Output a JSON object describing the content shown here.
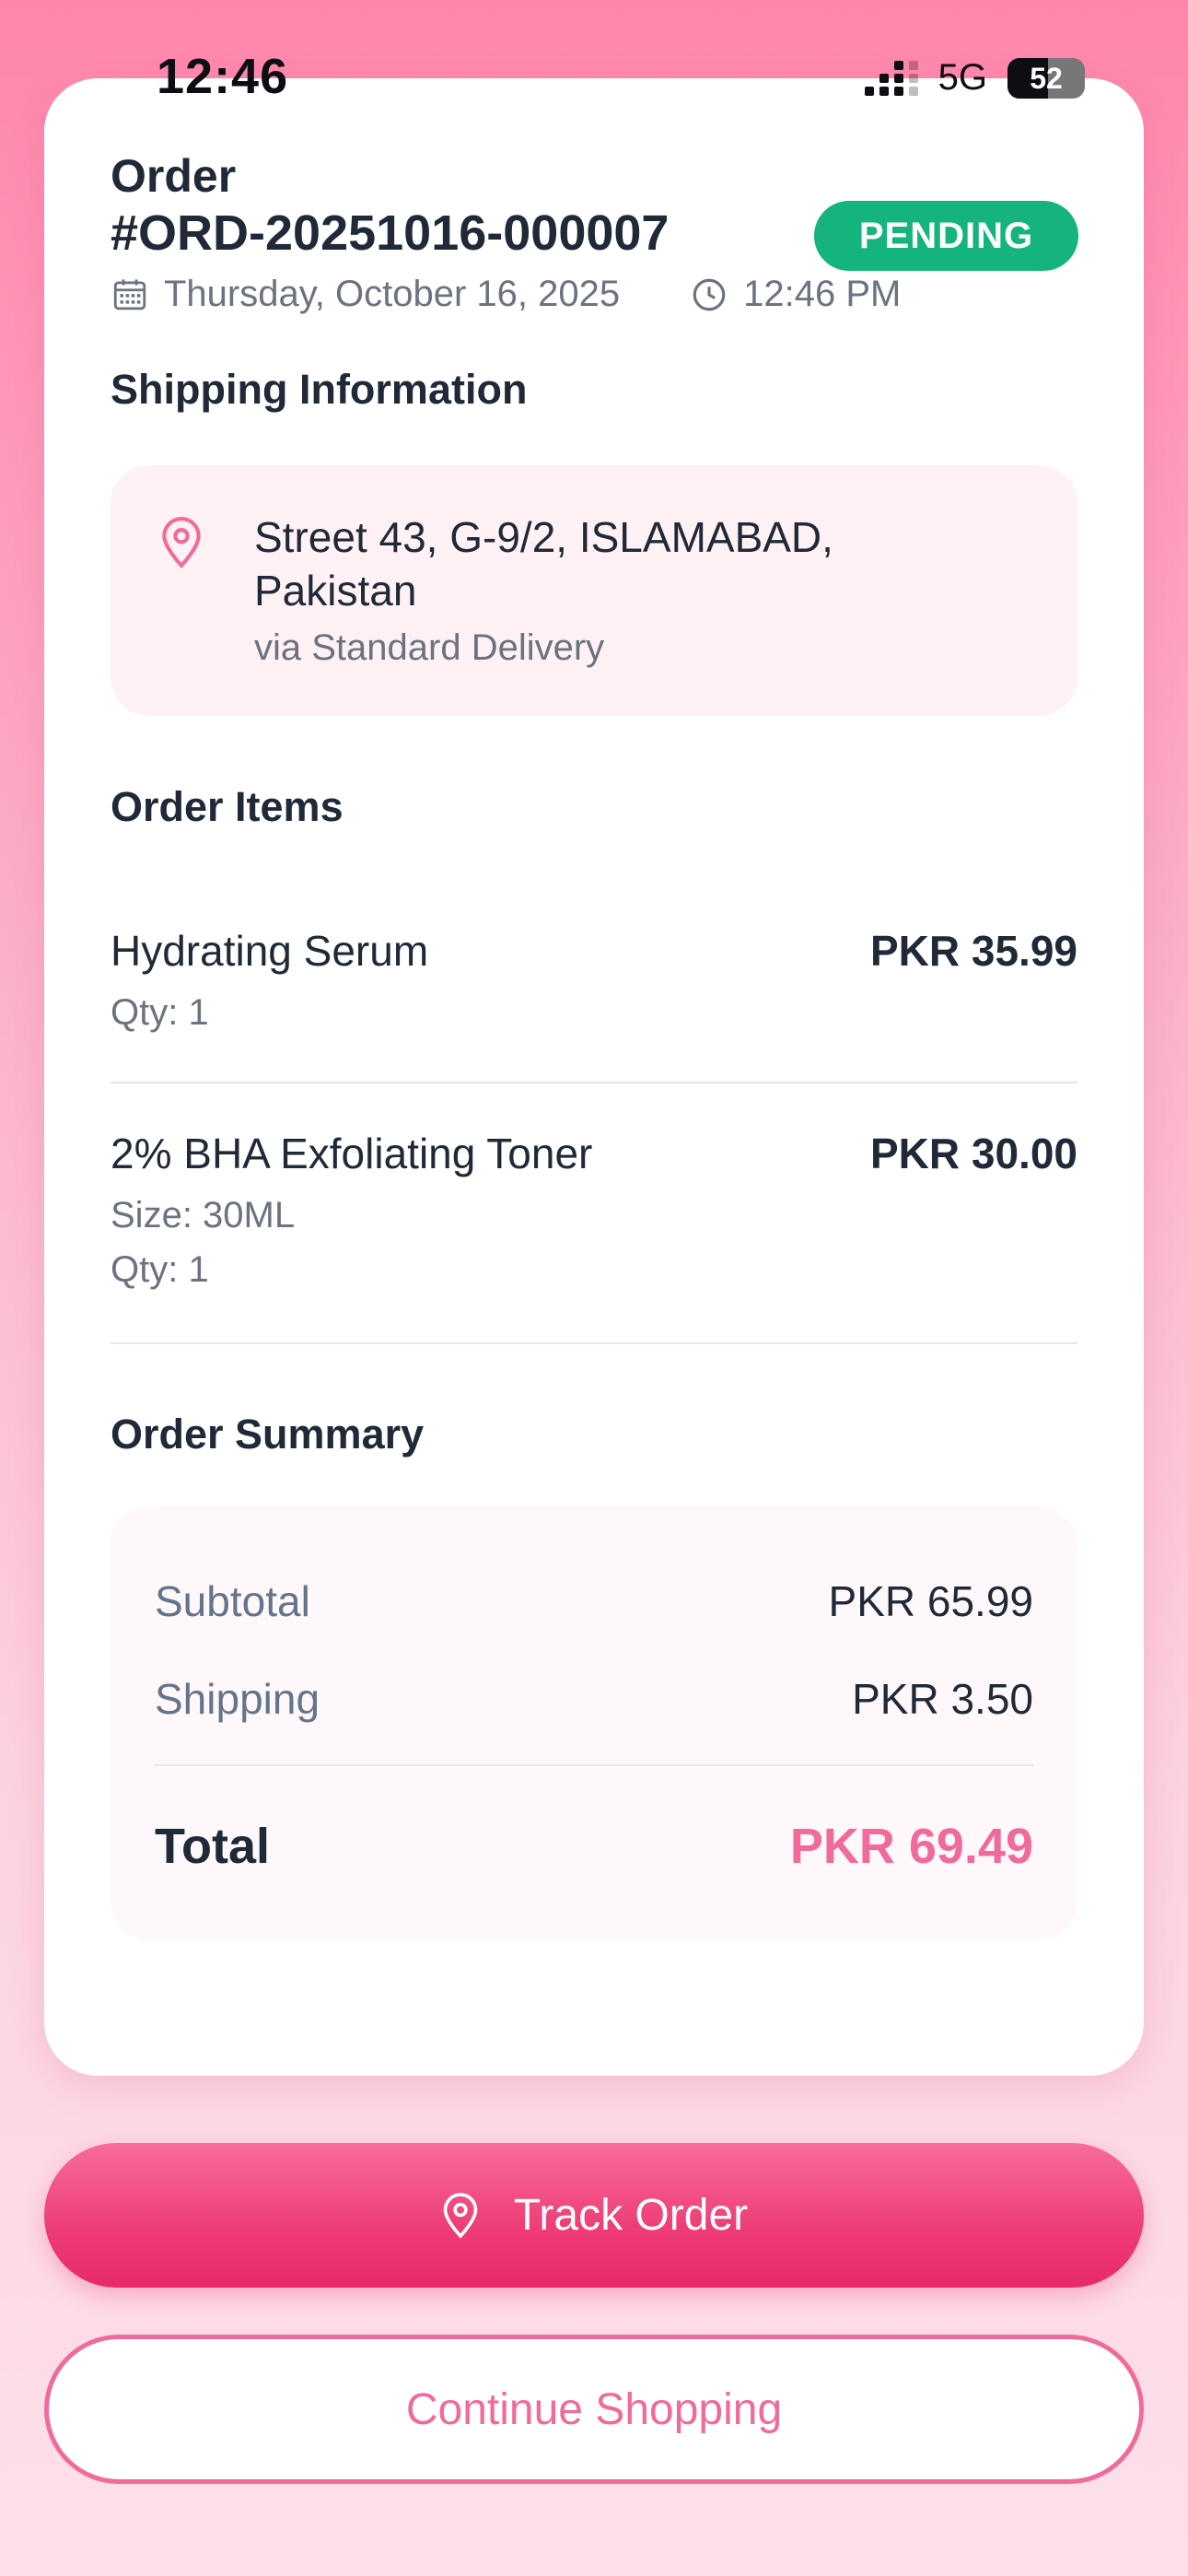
{
  "status_bar": {
    "time": "12:46",
    "network": "5G",
    "battery": "52"
  },
  "order": {
    "label": "Order",
    "number": "#ORD-20251016-000007",
    "status": "PENDING",
    "date": "Thursday, October 16, 2025",
    "time": "12:46 PM",
    "icons": {
      "date": "calendar-icon",
      "time": "clock-icon"
    }
  },
  "shipping": {
    "title": "Shipping Information",
    "address": "Street 43, G-9/2, ISLAMABAD, Pakistan",
    "via": "via Standard Delivery",
    "icon": "location-pin-icon"
  },
  "items": {
    "title": "Order Items",
    "list": [
      {
        "name": "Hydrating Serum",
        "price": "PKR 35.99",
        "size": "",
        "qty": "Qty: 1"
      },
      {
        "name": "2% BHA Exfoliating Toner",
        "price": "PKR 30.00",
        "size": "Size: 30ML",
        "qty": "Qty: 1"
      }
    ]
  },
  "summary": {
    "title": "Order Summary",
    "subtotal_label": "Subtotal",
    "subtotal_value": "PKR 65.99",
    "shipping_label": "Shipping",
    "shipping_value": "PKR 3.50",
    "total_label": "Total",
    "total_value": "PKR 69.49"
  },
  "actions": {
    "track_label": "Track Order",
    "track_icon": "location-pin-icon",
    "continue_label": "Continue Shopping"
  },
  "colors": {
    "accent": "#f06a9b",
    "status_pending": "#16b47d",
    "track_button": "#ee3c77"
  }
}
